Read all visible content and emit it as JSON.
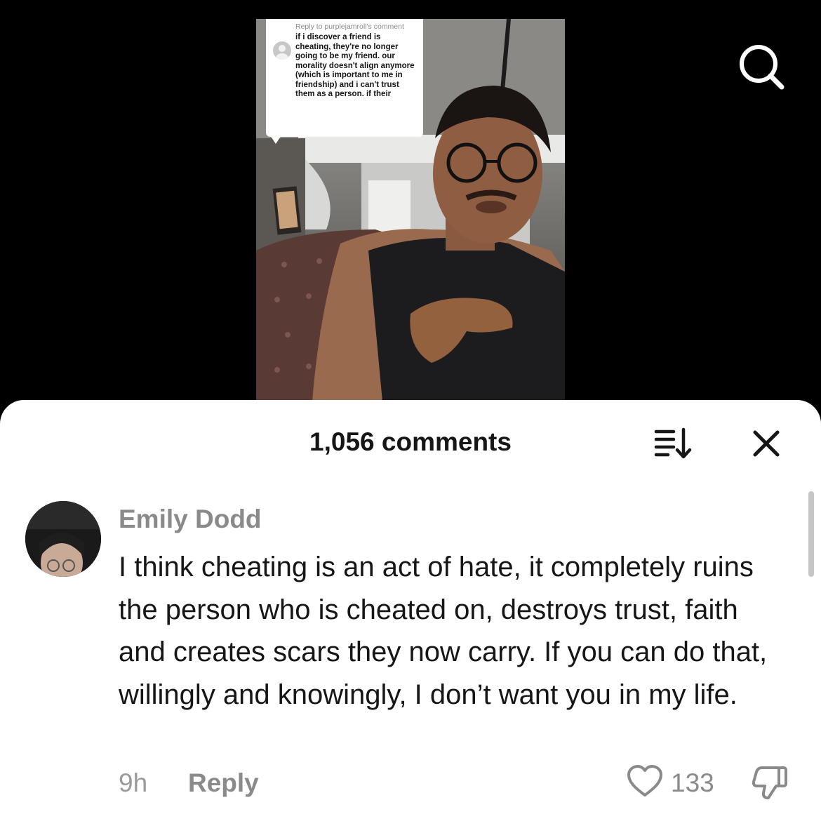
{
  "video": {
    "reply_header": "Reply to purplejamroll's comment",
    "reply_text": "if i discover a friend is cheating, they're no longer going to be my friend. our morality doesn't align anymore (which is important to me in friendship) and i can't trust them as a person. if their"
  },
  "top_bar": {
    "search_icon": "search-icon"
  },
  "comments_panel": {
    "title": "1,056 comments",
    "sort_icon": "sort-icon",
    "close_icon": "close-icon"
  },
  "comment": {
    "username": "Emily Dodd",
    "text": "I think cheating is an act of hate, it completely ruins the person who is cheated on, destroys trust, faith and creates scars they now carry. If you can do that, willingly and knowingly, I don’t want you in my life.",
    "time": "9h",
    "reply_label": "Reply",
    "like_icon": "heart-icon",
    "like_count": "133",
    "dislike_icon": "thumbs-down-icon"
  },
  "colors": {
    "sheet_background": "#ffffff",
    "primary_text": "#161616",
    "secondary_text": "#8a8a8a",
    "backdrop": "#000000"
  }
}
